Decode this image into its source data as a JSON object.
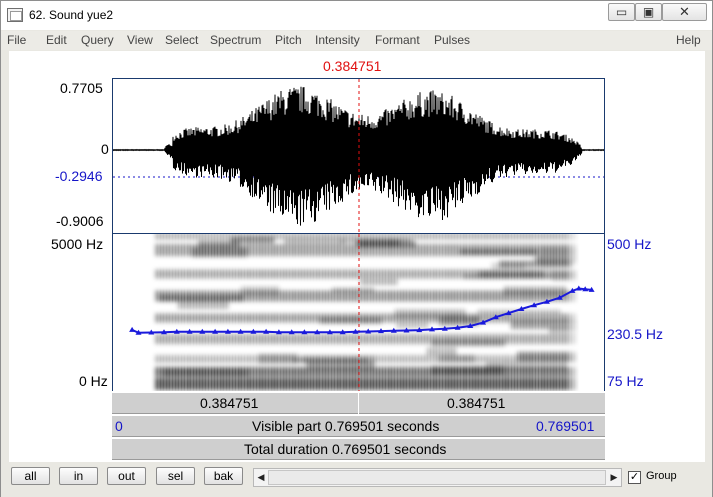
{
  "window": {
    "title": "62. Sound yue2",
    "minimize_glyph": "▭",
    "maximize_glyph": "▣",
    "close_glyph": "✕"
  },
  "menu": {
    "items": [
      "File",
      "Edit",
      "Query",
      "View",
      "Select",
      "Spectrum",
      "Pitch",
      "Intensity",
      "Formant",
      "Pulses"
    ],
    "help": "Help"
  },
  "cursor": {
    "time_label": "0.384751"
  },
  "waveform": {
    "max_label": "0.7705",
    "zero_label": "0",
    "sel_label": "-0.2946",
    "min_label": "-0.9006"
  },
  "spectrogram": {
    "top_freq_label": "5000 Hz",
    "bottom_freq_label": "0 Hz",
    "pitch_top_label": "500 Hz",
    "pitch_mid_label": "230.5 Hz",
    "pitch_bottom_label": "75 Hz"
  },
  "time_bars": {
    "left_segment": "0.384751",
    "right_segment": "0.384751",
    "visible_start": "0",
    "visible_part": "Visible part 0.769501 seconds",
    "visible_end": "0.769501",
    "total_duration": "Total duration 0.769501 seconds"
  },
  "bottom": {
    "buttons": [
      "all",
      "in",
      "out",
      "sel",
      "bak"
    ],
    "scroll_left_glyph": "◀",
    "scroll_right_glyph": "▶",
    "group_check_glyph": "✓",
    "group_label": "Group",
    "group_checked": true
  },
  "colors": {
    "waveform": "#000000",
    "cursor": "#e01010",
    "pitch": "#1a1adc",
    "labels_blue": "#1515c8"
  },
  "chart_data": {
    "type": "line",
    "pitch_track_hz": [
      {
        "t": 0.03,
        "hz": 230.5
      },
      {
        "t": 0.04,
        "hz": 222
      },
      {
        "t": 0.06,
        "hz": 223
      },
      {
        "t": 0.08,
        "hz": 224
      },
      {
        "t": 0.1,
        "hz": 225
      },
      {
        "t": 0.12,
        "hz": 225
      },
      {
        "t": 0.14,
        "hz": 225
      },
      {
        "t": 0.16,
        "hz": 225
      },
      {
        "t": 0.18,
        "hz": 225
      },
      {
        "t": 0.2,
        "hz": 225
      },
      {
        "t": 0.22,
        "hz": 225
      },
      {
        "t": 0.24,
        "hz": 225
      },
      {
        "t": 0.26,
        "hz": 224
      },
      {
        "t": 0.28,
        "hz": 224
      },
      {
        "t": 0.3,
        "hz": 224
      },
      {
        "t": 0.32,
        "hz": 224
      },
      {
        "t": 0.34,
        "hz": 224
      },
      {
        "t": 0.36,
        "hz": 224
      },
      {
        "t": 0.38,
        "hz": 225
      },
      {
        "t": 0.4,
        "hz": 226
      },
      {
        "t": 0.42,
        "hz": 227
      },
      {
        "t": 0.44,
        "hz": 228
      },
      {
        "t": 0.46,
        "hz": 229
      },
      {
        "t": 0.48,
        "hz": 230
      },
      {
        "t": 0.5,
        "hz": 232
      },
      {
        "t": 0.52,
        "hz": 234
      },
      {
        "t": 0.54,
        "hz": 237
      },
      {
        "t": 0.56,
        "hz": 242
      },
      {
        "t": 0.58,
        "hz": 252
      },
      {
        "t": 0.6,
        "hz": 268
      },
      {
        "t": 0.62,
        "hz": 280
      },
      {
        "t": 0.64,
        "hz": 292
      },
      {
        "t": 0.66,
        "hz": 303
      },
      {
        "t": 0.68,
        "hz": 313
      },
      {
        "t": 0.7,
        "hz": 325
      },
      {
        "t": 0.72,
        "hz": 345
      },
      {
        "t": 0.73,
        "hz": 352
      },
      {
        "t": 0.74,
        "hz": 350
      },
      {
        "t": 0.75,
        "hz": 348
      }
    ],
    "pitch_range_hz": [
      75,
      500
    ],
    "time_range_s": [
      0,
      0.769501
    ],
    "cursor_time_s": 0.384751,
    "waveform_range": [
      -0.9006,
      0.7705
    ]
  }
}
